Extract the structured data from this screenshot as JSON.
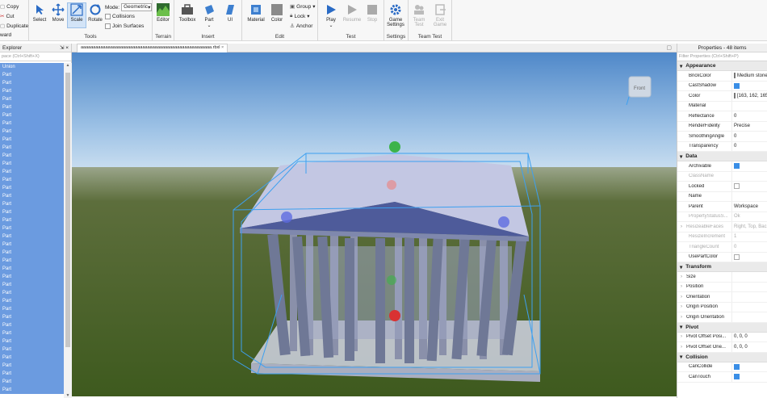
{
  "ribbon": {
    "clipboard": {
      "copy": "Copy",
      "cut": "Cut",
      "duplicate": "Duplicate",
      "paste_partial": "ward"
    },
    "tools": {
      "select": "Select",
      "move": "Move",
      "scale": "Scale",
      "rotate": "Rotate",
      "mode_label": "Mode:",
      "mode_value": "Geometric",
      "collisions": "Collisions",
      "join_surfaces": "Join Surfaces",
      "group_label": "Tools"
    },
    "terrain": {
      "editor": "Editor",
      "group_label": "Terrain"
    },
    "insert": {
      "toolbox": "Toolbox",
      "part": "Part",
      "ui": "UI",
      "group_label": "Insert"
    },
    "edit": {
      "material": "Material",
      "color": "Color",
      "group": "Group",
      "lock": "Lock",
      "anchor": "Anchor",
      "group_label": "Edit"
    },
    "test": {
      "play": "Play",
      "resume": "Resume",
      "stop": "Stop",
      "group_label": "Test"
    },
    "settings": {
      "game_settings_1": "Game",
      "game_settings_2": "Settings",
      "group_label": "Settings"
    },
    "team_test": {
      "team_test_1": "Team",
      "team_test_2": "Test",
      "exit_game_1": "Exit",
      "exit_game_2": "Game",
      "group_label": "Team Test"
    }
  },
  "explorer": {
    "title": "Explorer",
    "filter_placeholder": "pace (Ctrl+Shift+X)",
    "items": [
      "Union",
      "Part",
      "Part",
      "Part",
      "Part",
      "Part",
      "Part",
      "Part",
      "Part",
      "Part",
      "Part",
      "Part",
      "Part",
      "Part",
      "Part",
      "Part",
      "Part",
      "Part",
      "Part",
      "Part",
      "Part",
      "Part",
      "Part",
      "Part",
      "Part",
      "Part",
      "Part",
      "Part",
      "Part",
      "Part",
      "Part",
      "Part",
      "Part",
      "Part",
      "Part",
      "Part",
      "Part",
      "Part",
      "Part",
      "Part",
      "Part"
    ]
  },
  "document": {
    "tab_name": "aaaaaaaaaaaaaaaaaaaaaaaaaaaaaaaaaaaaaaaaaaaaaaaaaaaaa.rbxl"
  },
  "viewport": {
    "view_cube_label": "Front"
  },
  "properties": {
    "title": "Properties - 48 items",
    "filter_placeholder": "Filter Properties (Ctrl+Shift+P)",
    "sections": [
      {
        "name": "Appearance",
        "rows": [
          {
            "name": "BrickColor",
            "value": "Medium stone",
            "swatch": "#a3a2a5"
          },
          {
            "name": "CastShadow",
            "check": true
          },
          {
            "name": "Color",
            "value": "[163, 162, 165]",
            "swatch": "#a3a2a5"
          },
          {
            "name": "Material",
            "value": ""
          },
          {
            "name": "Reflectance",
            "value": "0"
          },
          {
            "name": "RenderFidelity",
            "value": "Precise"
          },
          {
            "name": "SmoothingAngle",
            "value": "0"
          },
          {
            "name": "Transparency",
            "value": "0"
          }
        ]
      },
      {
        "name": "Data",
        "rows": [
          {
            "name": "Archivable",
            "check": true
          },
          {
            "name": "ClassName",
            "value": "",
            "disabled": true
          },
          {
            "name": "Locked",
            "check": false
          },
          {
            "name": "Name",
            "value": ""
          },
          {
            "name": "Parent",
            "value": "Workspace"
          },
          {
            "name": "PropertyStatusS...",
            "value": "Ok",
            "disabled": true
          },
          {
            "name": "ResizeableFaces",
            "value": "Right, Top, Back",
            "disabled": true,
            "expand": true
          },
          {
            "name": "ResizeIncrement",
            "value": "1",
            "disabled": true
          },
          {
            "name": "TriangleCount",
            "value": "0",
            "disabled": true
          },
          {
            "name": "UsePartColor",
            "check": false
          }
        ]
      },
      {
        "name": "Transform",
        "rows": [
          {
            "name": "Size",
            "value": "",
            "expand": true
          },
          {
            "name": "Position",
            "value": "",
            "expand": true
          },
          {
            "name": "Orientation",
            "value": "",
            "expand": true
          },
          {
            "name": "Origin Position",
            "value": "",
            "expand": true
          },
          {
            "name": "Origin Orientation",
            "value": "",
            "expand": true
          }
        ]
      },
      {
        "name": "Pivot",
        "rows": [
          {
            "name": "Pivot Offset Posi...",
            "value": "0, 0, 0",
            "expand": true
          },
          {
            "name": "Pivot Offset Orie...",
            "value": "0, 0, 0",
            "expand": true
          }
        ]
      },
      {
        "name": "Collision",
        "rows": [
          {
            "name": "CanCollide",
            "check": true
          },
          {
            "name": "CanTouch",
            "check": true
          }
        ]
      }
    ]
  },
  "colors": {
    "selection": "#6b9be0",
    "accent": "#3a8ee6"
  }
}
